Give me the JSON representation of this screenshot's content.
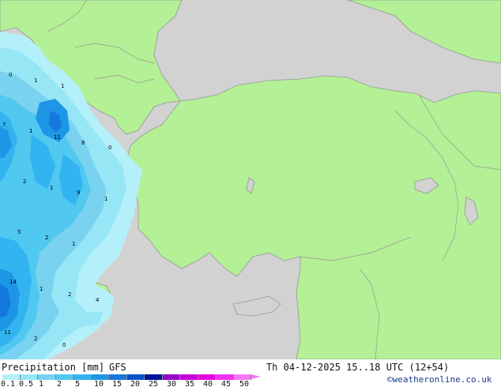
{
  "title": {
    "variable": "Precipitation [mm]",
    "model": "GFS",
    "valid_time": "Th 04-12-2025 15..18 UTC (12+54)",
    "credit": "©weatheronline.co.uk"
  },
  "legend": {
    "ticks": [
      "0.1",
      "0.5",
      "1",
      "2",
      "5",
      "10",
      "15",
      "20",
      "25",
      "30",
      "35",
      "40",
      "45",
      "50"
    ],
    "colors": [
      "#b4f0fa",
      "#96e6f5",
      "#78d2f0",
      "#50c8f0",
      "#32b4f0",
      "#1e96e6",
      "#1478dc",
      "#0a50c8",
      "#00149b",
      "#9600c8",
      "#c800dc",
      "#e600e6",
      "#f032f0",
      "#f578f5"
    ]
  },
  "map_colors": {
    "sea": "#d2d2d2",
    "land": "#b4f096",
    "border": "#969696"
  },
  "precip_labels": [
    "0",
    "1",
    "1",
    "7",
    "1",
    "11",
    "8",
    "0",
    "2",
    "1",
    "9",
    "1",
    "5",
    "2",
    "1",
    "14",
    "1",
    "2",
    "4",
    "11",
    "2",
    "0"
  ]
}
